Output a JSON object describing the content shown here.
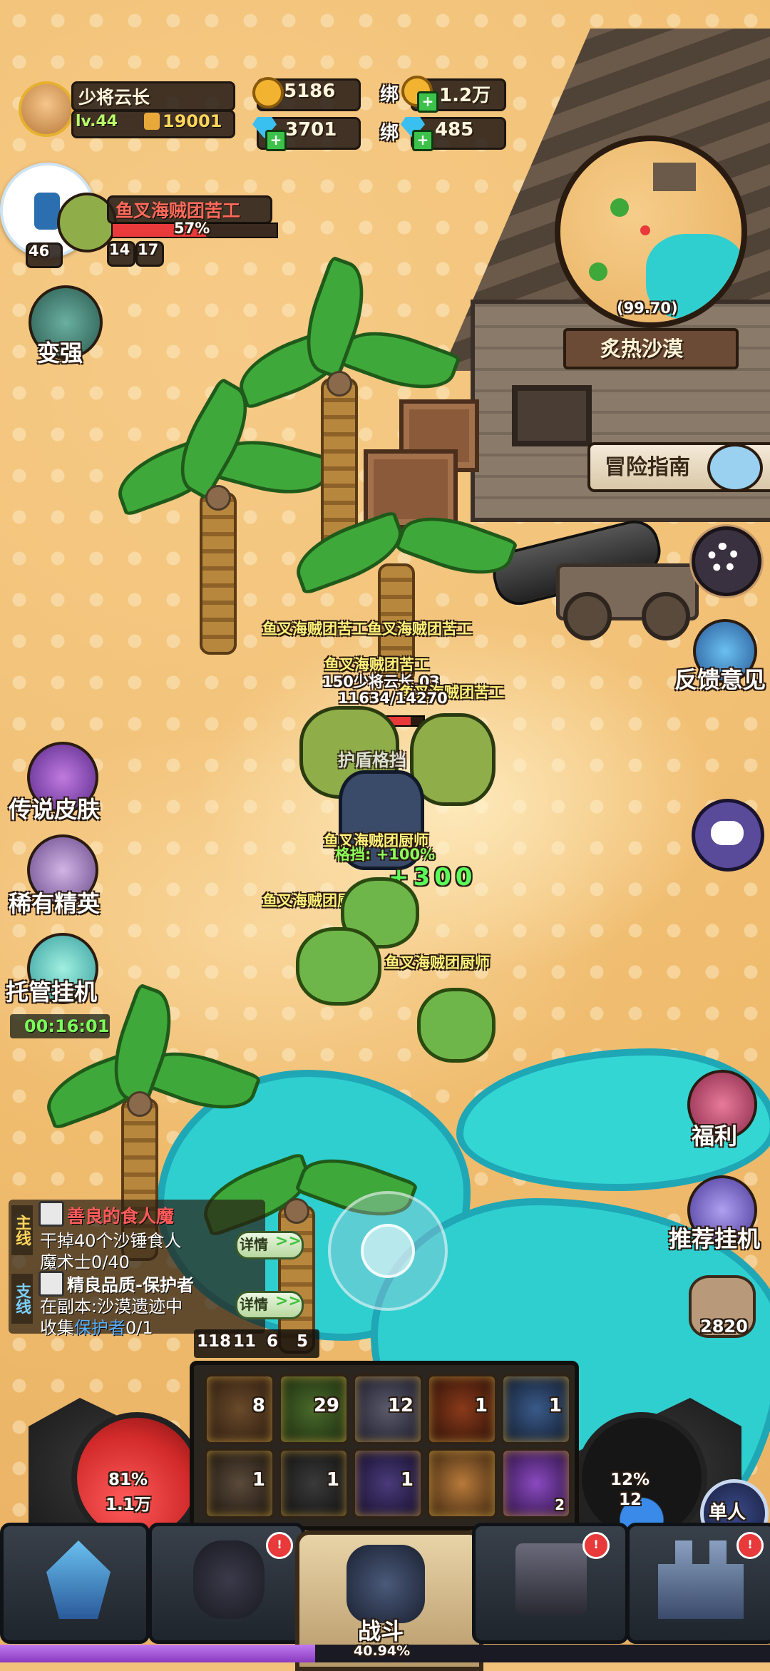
{
  "player": {
    "name": "少将云长",
    "level": "lv.44",
    "power": "19001"
  },
  "currency": {
    "gold": "5186",
    "bound_gold_label": "绑",
    "bound_gold": "1.2万",
    "diamond": "3701",
    "bound_diamond_label": "绑",
    "bound_diamond": "485"
  },
  "target": {
    "name": "鱼叉海贼团苦工",
    "hp_pct": "57%",
    "level": "46",
    "stat_a": "14",
    "stat_b": "17"
  },
  "minimap": {
    "coords": "(99.70)",
    "zone": "炙热沙漠"
  },
  "left_menu": {
    "strengthen": "变强",
    "legend_skin": "传说皮肤",
    "rare_elite": "稀有精英",
    "auto_hang": "托管挂机",
    "auto_timer": "00:16:01"
  },
  "right_menu": {
    "adventure_guide": "冒险指南",
    "feedback": "反馈意见",
    "welfare": "福利",
    "recommend_hang": "推荐挂机",
    "stone_count": "2820",
    "single": "单人"
  },
  "battle": {
    "enemy_labels": [
      "鱼叉海贼团苦工鱼叉海贼团苦工",
      "鱼叉海贼团苦工",
      "鱼叉海贼团苦工",
      "鱼叉海贼团厨师",
      "鱼叉海贼团厨师",
      "鱼叉海贼团厨师"
    ],
    "player_tag": "150少将云长.03",
    "player_hp": "11634/14270",
    "shield_text": "护盾格挡",
    "block_text": "格挡: +100%",
    "heal_text": "+300"
  },
  "quests": {
    "main_tag": "主线",
    "main_title": "善良的食人魔",
    "main_line1": "干掉40个沙锤食人",
    "main_line2": "魔术士0/40",
    "detail": "详情",
    "side_tag": "支线",
    "side_title": "精良品质-保护者",
    "side_line1": "在副本:沙漠遗迹中",
    "side_line2_prefix": "收集",
    "side_line2_key": "保护者",
    "side_line2_val": "0/1"
  },
  "hotbar": {
    "counters": [
      "118",
      "11",
      "6",
      "5"
    ],
    "row1": [
      "8",
      "29",
      "12",
      "1",
      "1"
    ],
    "row2": [
      "1",
      "1",
      "1",
      "",
      "2"
    ]
  },
  "orbs": {
    "hp_pct": "81%",
    "hp_val": "1.1万",
    "mp_pct": "12%",
    "mp_val": "12"
  },
  "bottom_nav": {
    "battle": "战斗",
    "exp_pct": "40.94%"
  },
  "colors": {
    "hp": "#e83a3a",
    "gold_bg": "#2a1f16",
    "water": "#2fcfcf",
    "sand": "#f2c27a"
  }
}
